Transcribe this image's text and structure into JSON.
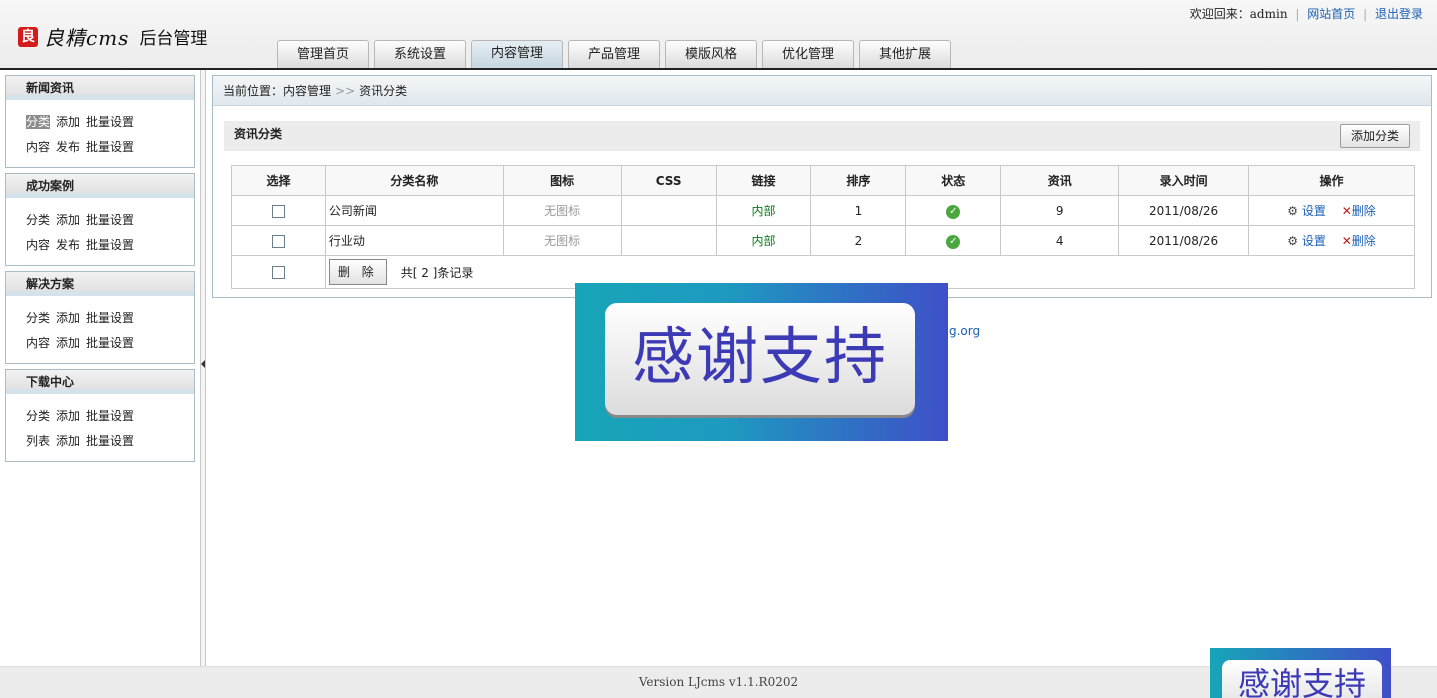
{
  "header": {
    "logo_mark": "良",
    "logo_name": "良精cms",
    "logo_sub": "后台管理",
    "welcome": "欢迎回来：admin",
    "link_home": "网站首页",
    "link_logout": "退出登录"
  },
  "nav": {
    "tabs": [
      {
        "label": "管理首页"
      },
      {
        "label": "系统设置"
      },
      {
        "label": "内容管理"
      },
      {
        "label": "产品管理"
      },
      {
        "label": "模版风格"
      },
      {
        "label": "优化管理"
      },
      {
        "label": "其他扩展"
      }
    ]
  },
  "sidebar": {
    "groups": [
      {
        "title": "新闻资讯",
        "rows": [
          [
            "分类",
            "添加",
            "批量设置"
          ],
          [
            "内容",
            "发布",
            "批量设置"
          ]
        ]
      },
      {
        "title": "成功案例",
        "rows": [
          [
            "分类",
            "添加",
            "批量设置"
          ],
          [
            "内容",
            "发布",
            "批量设置"
          ]
        ]
      },
      {
        "title": "解决方案",
        "rows": [
          [
            "分类",
            "添加",
            "批量设置"
          ],
          [
            "内容",
            "添加",
            "批量设置"
          ]
        ]
      },
      {
        "title": "下载中心",
        "rows": [
          [
            "分类",
            "添加",
            "批量设置"
          ],
          [
            "列表",
            "添加",
            "批量设置"
          ]
        ]
      }
    ]
  },
  "breadcrumb": {
    "prefix": "当前位置：",
    "section": "内容管理",
    "arrow": ">>",
    "page": "资讯分类"
  },
  "section": {
    "title": "资讯分类",
    "add_button": "添加分类"
  },
  "table": {
    "headers": [
      "选择",
      "分类名称",
      "图标",
      "CSS",
      "链接",
      "排序",
      "状态",
      "资讯",
      "录入时间",
      "操作"
    ],
    "rows": [
      {
        "name": "公司新闻",
        "icon": "无图标",
        "css": "",
        "link": "内部",
        "order": "1",
        "status_icon": "check-circle-icon",
        "count": "9",
        "date": "2011/08/26",
        "op_set": "设置",
        "op_del": "删除"
      },
      {
        "name": "行业动",
        "icon": "无图标",
        "css": "",
        "link": "内部",
        "order": "2",
        "status_icon": "check-circle-icon",
        "count": "4",
        "date": "2011/08/26",
        "op_set": "设置",
        "op_del": "删除"
      }
    ],
    "delete_button": "删 除",
    "total": "共[ 2 ]条记录"
  },
  "overlay": {
    "banner_text": "感谢支持",
    "peek_text": "g.org",
    "banner2_text": "感谢支持"
  },
  "footer": {
    "version": "Version LJcms v1.1.R0202"
  }
}
